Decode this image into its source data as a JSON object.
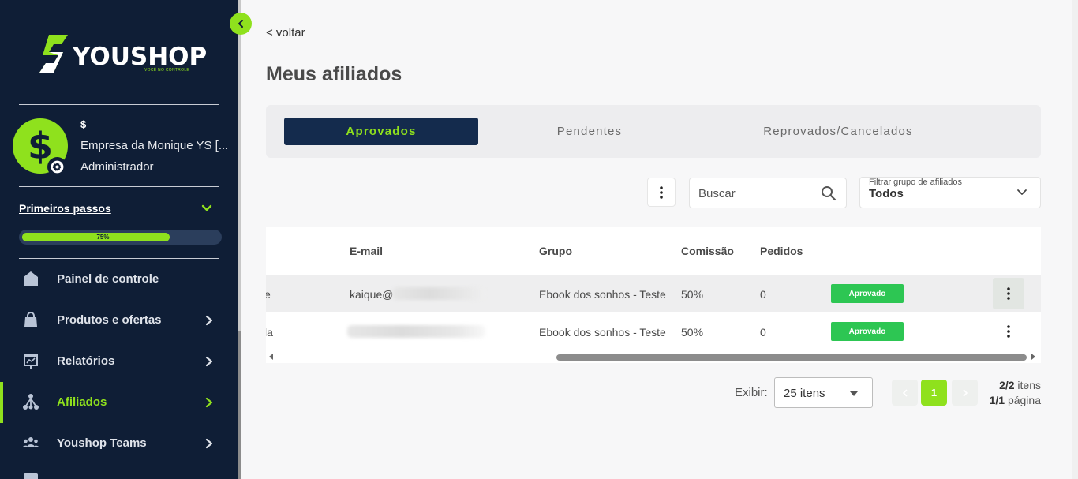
{
  "sidebar": {
    "logo_text": "YOUSHOP",
    "logo_tagline": "VOCÊ NO CONTROLE",
    "account": {
      "currency_sign": "$",
      "avatar_symbol": "$",
      "company_name": "Empresa da Monique YS [...",
      "role": "Administrador"
    },
    "first_steps": {
      "title": "Primeiros passos",
      "progress_label": "75%",
      "progress_fraction": 0.75
    },
    "items": [
      {
        "label": "Painel de controle",
        "icon": "home-icon"
      },
      {
        "label": "Produtos e ofertas",
        "icon": "bag-icon"
      },
      {
        "label": "Relatórios",
        "icon": "report-board-icon"
      },
      {
        "label": "Afiliados",
        "icon": "network-icon",
        "active": true
      },
      {
        "label": "Youshop Teams",
        "icon": "team-icon"
      }
    ]
  },
  "main": {
    "back_label": "< voltar",
    "title": "Meus afiliados",
    "tabs": [
      {
        "label": "Aprovados",
        "active": true
      },
      {
        "label": "Pendentes"
      },
      {
        "label": "Reprovados/Cancelados"
      }
    ],
    "search": {
      "placeholder": "Buscar"
    },
    "filter": {
      "label": "Filtrar grupo de afiliados",
      "value": "Todos"
    },
    "table": {
      "columns": [
        "E-mail",
        "Grupo",
        "Comissão",
        "Pedidos"
      ],
      "rows": [
        {
          "name_tail": "e",
          "email": "kaique@",
          "group": "Ebook dos sonhos - Teste",
          "commission": "50%",
          "orders": "0",
          "status": "Aprovado"
        },
        {
          "name_tail": "la",
          "email": "",
          "group": "Ebook dos sonhos - Teste",
          "commission": "50%",
          "orders": "0",
          "status": "Aprovado"
        }
      ]
    },
    "pagination": {
      "show_label": "Exibir:",
      "per_page": "25 itens",
      "current_page": "1",
      "items_count": "2/2",
      "items_word": "itens",
      "pages_count": "1/1",
      "pages_word": "página"
    }
  },
  "colors": {
    "sidebar_bg": "#0f1e36",
    "accent": "#8fe11d",
    "tab_active_bg": "#142b4d",
    "status_green": "#2dc653"
  }
}
